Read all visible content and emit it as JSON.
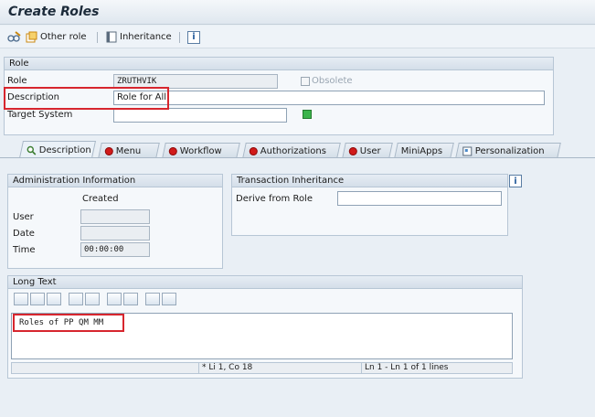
{
  "window": {
    "title": "Create Roles"
  },
  "toolbar": {
    "other_role": "Other role",
    "inheritance": "Inheritance",
    "info": "i"
  },
  "role_section": {
    "header": "Role",
    "role_label": "Role",
    "role_value": "ZRUTHVIK",
    "obsolete_label": "Obsolete",
    "description_label": "Description",
    "description_value": "Role for All",
    "target_system_label": "Target System",
    "target_system_value": ""
  },
  "tabs": [
    {
      "label": "Description"
    },
    {
      "label": "Menu"
    },
    {
      "label": "Workflow"
    },
    {
      "label": "Authorizations"
    },
    {
      "label": "User"
    },
    {
      "label": "MiniApps"
    },
    {
      "label": "Personalization"
    }
  ],
  "admin_info": {
    "header": "Administration Information",
    "created_label": "Created",
    "user_label": "User",
    "user_value": "",
    "date_label": "Date",
    "date_value": "",
    "time_label": "Time",
    "time_value": "00:00:00"
  },
  "transaction_inheritance": {
    "header": "Transaction Inheritance",
    "derive_label": "Derive from Role",
    "derive_value": "",
    "info": "i"
  },
  "long_text": {
    "header": "Long Text",
    "content": "Roles of PP QM MM",
    "status_mid": "* Li 1, Co 18",
    "status_right": "Ln 1 - Ln 1 of 1 lines"
  },
  "colors": {
    "highlight": "#d7262e",
    "status_green": "#3cb44b",
    "tab_red": "#d11a1a"
  }
}
